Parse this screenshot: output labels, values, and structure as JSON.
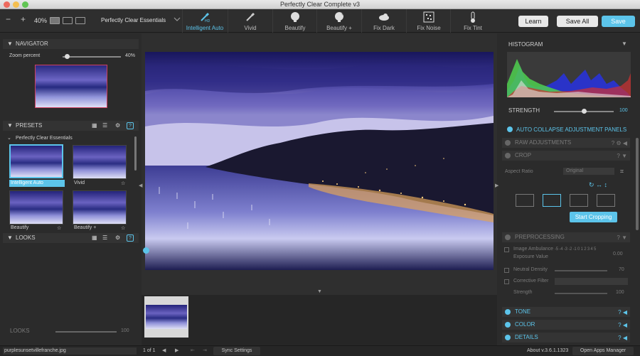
{
  "window": {
    "title": "Perfectly Clear Complete v3"
  },
  "toolbar": {
    "zoom_minus": "−",
    "zoom_plus": "+",
    "zoom_level": "40%",
    "preset_name": "Perfectly Clear Essentials",
    "tools": [
      {
        "label": "Intelligent Auto",
        "icon": "brush-hd-icon",
        "active": true
      },
      {
        "label": "Vivid",
        "icon": "brush-icon",
        "active": false
      },
      {
        "label": "Beautify",
        "icon": "face-icon",
        "active": false
      },
      {
        "label": "Beautify +",
        "icon": "face-plus-icon",
        "active": false
      },
      {
        "label": "Fix Dark",
        "icon": "cloud-icon",
        "active": false
      },
      {
        "label": "Fix Noise",
        "icon": "noise-icon",
        "active": false
      },
      {
        "label": "Fix Tint",
        "icon": "thermometer-icon",
        "active": false
      }
    ],
    "learn": "Learn",
    "save_all": "Save All",
    "save": "Save"
  },
  "navigator": {
    "title": "NAVIGATOR",
    "zoom_label": "Zoom percent",
    "zoom_value": "40%",
    "zoom_fraction": 0.07
  },
  "presets": {
    "title": "PRESETS",
    "group": "Perfectly Clear Essentials",
    "items": [
      {
        "label": "Intelligent Auto",
        "selected": true
      },
      {
        "label": "Vivid",
        "selected": false
      },
      {
        "label": "Beautify",
        "selected": false
      },
      {
        "label": "Beautify +",
        "selected": false
      }
    ]
  },
  "looks": {
    "title": "LOOKS",
    "strength_label": "LOOKS",
    "strength_value": "100",
    "strength_fraction": 1.0
  },
  "right": {
    "histogram": "HISTOGRAM",
    "strength_label": "STRENGTH",
    "strength_value": "100",
    "strength_fraction": 0.5,
    "auto_collapse": "AUTO COLLAPSE ADJUSTMENT PANELS",
    "raw": "RAW ADJUSTMENTS",
    "crop": "CROP",
    "aspect_label": "Aspect Ratio",
    "aspect_value": "Original",
    "start_cropping": "Start Cropping",
    "preprocessing": "PREPROCESSING",
    "image_ambulance": "Image Ambulance",
    "exposure_value": "Exposure Value",
    "ev_scale": "-5 -4 -3 -2 -1 0 1 2 3 4 5",
    "ev_value": "0.00",
    "neutral_density": "Neutral Density",
    "nd_value": "70",
    "corrective_filter": "Corrective Filter",
    "strength": "Strength",
    "cf_strength_value": "100",
    "tone": "TONE",
    "color": "COLOR",
    "details": "DETAILS"
  },
  "status": {
    "filename": "purplesunsetvillefranche.jpg",
    "page": "1 of 1",
    "sync": "Sync Settings",
    "version": "About v.3.6.1.1323",
    "open_apps": "Open Apps Manager"
  },
  "colors": {
    "accent": "#5cc4ea",
    "panel": "#2b2b2b"
  }
}
